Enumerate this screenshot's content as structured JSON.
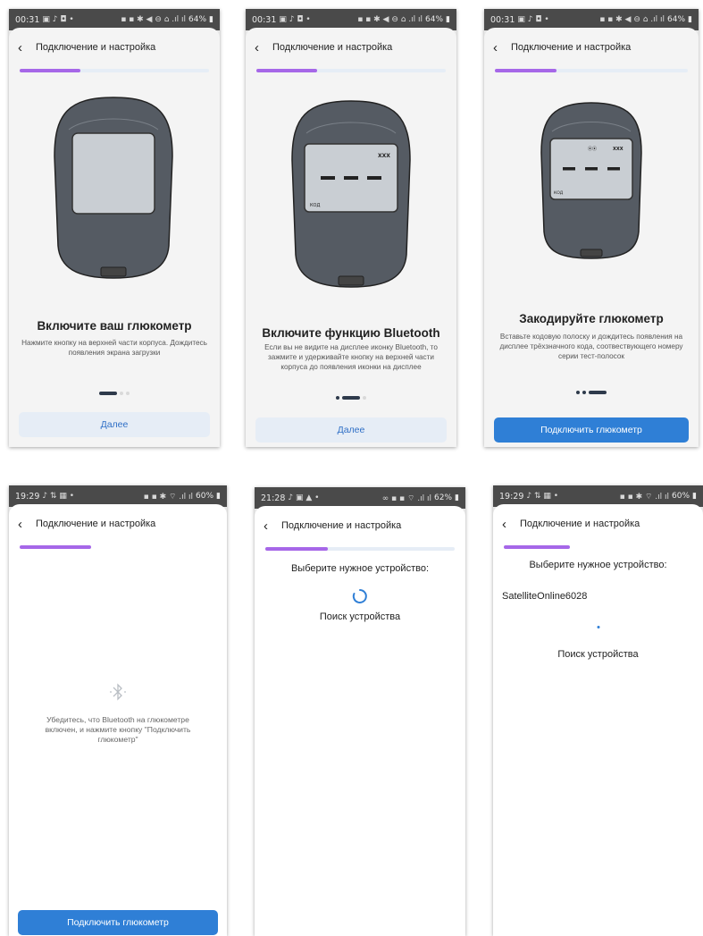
{
  "colors": {
    "accent": "#a667e8",
    "primary": "#2f7fd6",
    "button_light": "#e6edf6"
  },
  "screens": [
    {
      "status": {
        "time": "00:31",
        "left_icons": "▣ ♪ ◘ •",
        "right_icons": "▪ ▪ ✱ ◀ ⊖ ⌂ .ıl ıl",
        "battery": "64%"
      },
      "back_icon": "‹",
      "title": "Подключение и настройка",
      "progress": 0.32,
      "heading": "Включите ваш глюкометр",
      "desc": "Нажмите кнопку на верхней части корпуса. Дождитесь появления экрана загрузки",
      "page_index": 0,
      "button_label": "Далее"
    },
    {
      "status": {
        "time": "00:31",
        "left_icons": "▣ ♪ ◘ •",
        "right_icons": "▪ ▪ ✱ ◀ ⊖ ⌂ .ıl ıl",
        "battery": "64%"
      },
      "back_icon": "‹",
      "title": "Подключение и настройка",
      "progress": 0.32,
      "device_labels": {
        "battery": "XXX",
        "code": "КОД"
      },
      "heading": "Включите функцию Bluetooth",
      "desc": "Если вы не видите на дисплее иконку Bluetooth, то зажмите и удерживайте кнопку на верхней части корпуса до появления иконки на дисплее",
      "page_index": 1,
      "button_label": "Далее"
    },
    {
      "status": {
        "time": "00:31",
        "left_icons": "▣ ♪ ◘ •",
        "right_icons": "▪ ▪ ✱ ◀ ⊖ ⌂ .ıl ıl",
        "battery": "64%"
      },
      "back_icon": "‹",
      "title": "Подключение и настройка",
      "progress": 0.32,
      "device_labels": {
        "bluetooth": "⦿⦿",
        "battery": "XXX",
        "code": "КОД"
      },
      "heading": "Закодируйте глюкометр",
      "desc": "Вставьте кодовую полоску и дождитесь появления на дисплее трёхзначного кода, соотвествующего номеру серии тест-полосок",
      "page_index": 2,
      "button_label": "Подключить глюкометр"
    },
    {
      "status": {
        "time": "19:29",
        "left_icons": "♪ ⇅ ▦ •",
        "right_icons": "▪ ▪ ✱ ⌔ .ıl ıl",
        "battery": "60%"
      },
      "back_icon": "‹",
      "title": "Подключение и настройка",
      "progress": 0.33,
      "bt_icon": "bluetooth-icon",
      "hint": "Убедитесь, что Bluetooth на глюкометре включен, и нажмите кнопку \"Подключить глюкометр\"",
      "button_label": "Подключить глюкометр"
    },
    {
      "status": {
        "time": "21:28",
        "left_icons": "♪ ▣ ▲ •",
        "right_icons": "∞ ▪ ▪ ⌔ .ıl ıl",
        "battery": "62%"
      },
      "back_icon": "‹",
      "title": "Подключение и настройка",
      "progress": 0.33,
      "heading": "Выберите нужное устройство:",
      "searching": "Поиск устройства"
    },
    {
      "status": {
        "time": "19:29",
        "left_icons": "♪ ⇅ ▦ •",
        "right_icons": "▪ ▪ ✱ ⌔ .ıl ıl",
        "battery": "60%"
      },
      "back_icon": "‹",
      "title": "Подключение и настройка",
      "progress": 0.33,
      "heading": "Выберите нужное устройство:",
      "device_name": "SatelliteOnline6028",
      "searching": "Поиск устройства"
    }
  ]
}
